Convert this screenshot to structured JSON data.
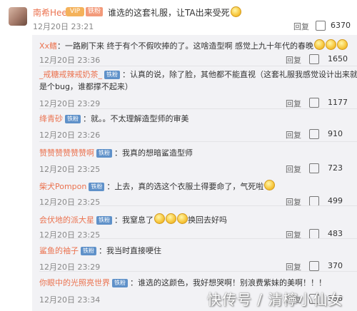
{
  "top": {
    "username": "南希Hee",
    "vip_badge": "VIP",
    "fan_badge": "铁粉",
    "text": "谁选的这套礼服，让TA出来受死",
    "time": "12月20日 23:21",
    "reply": "回复",
    "likes": "6370"
  },
  "replies": [
    {
      "user": "Xx鳍",
      "tag": "",
      "text": "：一路刷下来 终于有个不假吹捧的了。这啥造型啊 感觉上九十年代的春晚",
      "emoji": 3,
      "time": "12月20日 23:36",
      "reply": "回复",
      "likes": "1650"
    },
    {
      "user": "_戒糖戒辣戒奶茶_",
      "tag": "铁粉",
      "text": "：认真的说，除了脸，其他都不能直视（这套礼服我感觉设计出来就",
      "text2": "是个bug，谁都撑不起来）",
      "time": "12月20日 23:29",
      "reply": "回复",
      "likes": "1177"
    },
    {
      "user": "绛青砂",
      "tag": "铁粉",
      "text": "：就。。不太理解造型师的审美",
      "time": "12月20日 23:26",
      "reply": "回复",
      "likes": "910"
    },
    {
      "user": "赞赞赞赞赞赞啊",
      "tag": "铁粉",
      "text": "：我真的想暗鲨造型师",
      "time": "12月20日 23:25",
      "reply": "回复",
      "likes": "723"
    },
    {
      "user": "柴犬Pompon",
      "tag": "铁粉",
      "text": "：上去，真的选这个衣服土得要命了，气死啦",
      "emoji": 1,
      "time": "12月20日 23:25",
      "reply": "回复",
      "likes": "499"
    },
    {
      "user": "会伏地的派大星",
      "tag": "铁粉",
      "text": "：我窒息了",
      "emoji": 3,
      "text_after": "换回去好吗",
      "time": "12月20日 23:25",
      "reply": "回复",
      "likes": "483"
    },
    {
      "user": "鲨鱼的袖子",
      "tag": "铁粉",
      "text": "：我当时直接哽住",
      "time": "12月20日 23:29",
      "reply": "回复",
      "likes": "370"
    },
    {
      "user": "你眼中的光照亮世界",
      "tag": "铁粉",
      "text": "：谁选的这颜色，我好想哭啊！别浪费紫妹的美啊！！！",
      "time": "12月20日 23:34",
      "reply": "回复",
      "likes": "336"
    }
  ],
  "watermark": "快传号 / 清檸小仙女"
}
